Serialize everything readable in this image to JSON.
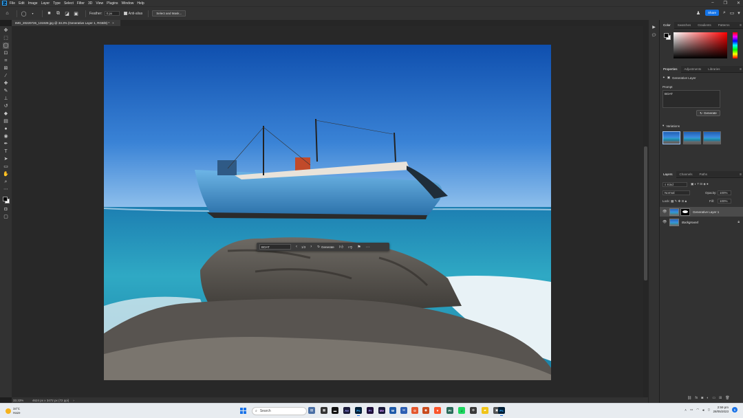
{
  "menu": {
    "items": [
      "File",
      "Edit",
      "Image",
      "Layer",
      "Type",
      "Select",
      "Filter",
      "3D",
      "View",
      "Plugins",
      "Window",
      "Help"
    ],
    "logo": "Ps"
  },
  "options": {
    "feather_label": "Feather:",
    "feather_value": "0 px",
    "antialias_label": "Anti-alias",
    "select_mask_label": "Select and Mask...",
    "share_label": "Share"
  },
  "document": {
    "tab_title": "IMG_20220726_131928.jpg @ 33.3% (Generative Layer 1, RGB/8) *",
    "zoom": "33.33%",
    "info": "4624 px x 3472 px (72 ppi)"
  },
  "context_bar": {
    "prompt": "BOAT",
    "count": "1/3",
    "generate_label": "Generate"
  },
  "color_panel": {
    "tabs": [
      "Color",
      "Swatches",
      "Gradients",
      "Patterns"
    ],
    "foreground": "#000000",
    "background": "#ffffff"
  },
  "properties_panel": {
    "tabs": [
      "Properties",
      "Adjustments",
      "Libraries"
    ],
    "layer_type": "Generative Layer",
    "prompt_label": "Prompt",
    "prompt_value": "BOAT",
    "generate_label": "Generate",
    "variations_label": "Variations"
  },
  "layers_panel": {
    "tabs": [
      "Layers",
      "Channels",
      "Paths"
    ],
    "filter_label": "Kind",
    "blend_mode": "Normal",
    "opacity_label": "Opacity:",
    "opacity_value": "100%",
    "lock_label": "Lock:",
    "fill_label": "Fill:",
    "fill_value": "100%",
    "layers": [
      {
        "name": "Generative Layer 1",
        "selected": true
      },
      {
        "name": "Background",
        "selected": false
      }
    ]
  },
  "windows_taskbar": {
    "temperature": "34°C",
    "weather_desc": "Haze",
    "search_placeholder": "Search",
    "time": "2:59 pm",
    "date": "28/05/2023",
    "notification_count": "5"
  }
}
